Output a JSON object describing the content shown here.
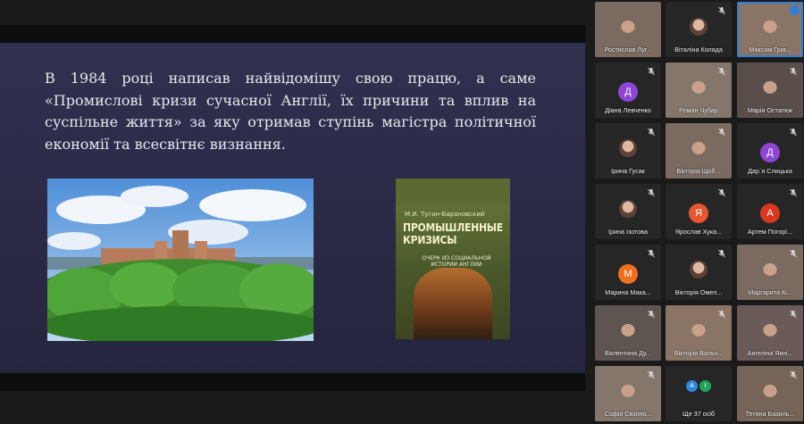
{
  "slide": {
    "text": "В 1984 році написав найвідомішу свою працю, а саме «Промислові кризи сучасної Англії, їх причини та вплив на суспільне життя» за яку отримав ступінь магістра політичної економії та всесвітнє визнання.",
    "book": {
      "author": "М.И. Туган-Барановский",
      "title_1": "ПРОМЫШЛЕННЫЕ",
      "title_2": "КРИЗИСЫ",
      "subtitle": "ОЧЕРК ИЗ СОЦИАЛЬНОЙ ИСТОРИИ АНГЛИИ"
    }
  },
  "participants": [
    {
      "name": "Ростислав Луг...",
      "type": "video",
      "muted": false
    },
    {
      "name": "Віталіна Коляда",
      "type": "avatar",
      "muted": true
    },
    {
      "name": "Максим Григ...",
      "type": "video",
      "muted": false,
      "active": true
    },
    {
      "name": "Діана Левченко",
      "type": "letter",
      "letter": "Д",
      "color": "#8e44d6",
      "muted": true
    },
    {
      "name": "Роман Чубар",
      "type": "video",
      "muted": true
    },
    {
      "name": "Марія Остапюк",
      "type": "video",
      "muted": true
    },
    {
      "name": "Ірина Гусак",
      "type": "avatar",
      "muted": true
    },
    {
      "name": "Вікторія Щоб...",
      "type": "video",
      "muted": true
    },
    {
      "name": "Дар`я Слицька",
      "type": "letter",
      "letter": "Д",
      "color": "#8e44d6",
      "muted": true
    },
    {
      "name": "Ірина Ізотова",
      "type": "avatar",
      "muted": true
    },
    {
      "name": "Ярослав Хука...",
      "type": "letter",
      "letter": "Я",
      "color": "#e8552e",
      "muted": true
    },
    {
      "name": "Артем Погорі...",
      "type": "letter",
      "letter": "А",
      "color": "#d9381e",
      "muted": true
    },
    {
      "name": "Марина Мака...",
      "type": "letter",
      "letter": "М",
      "color": "#f06f1e",
      "muted": true
    },
    {
      "name": "Вікторія Омел...",
      "type": "avatar",
      "muted": true
    },
    {
      "name": "Маргарита Кі...",
      "type": "video",
      "muted": true
    },
    {
      "name": "Валентина Ду...",
      "type": "video",
      "muted": true
    },
    {
      "name": "Вікторія Вальч...",
      "type": "video",
      "muted": true
    },
    {
      "name": "Ангеліна Якні...",
      "type": "video",
      "muted": true
    },
    {
      "name": "Софія Свзоно...",
      "type": "video",
      "muted": true
    },
    {
      "name": "Ще 37 осіб",
      "type": "more",
      "letters": [
        "А",
        "І"
      ]
    },
    {
      "name": "Тетяна Базиль...",
      "type": "video",
      "muted": true
    }
  ],
  "colors": {
    "slide_bg": "#2c2c48",
    "active_outline": "#2f7fd8",
    "more_badge_a": "#2f8ad9",
    "more_badge_i": "#24a35a"
  }
}
